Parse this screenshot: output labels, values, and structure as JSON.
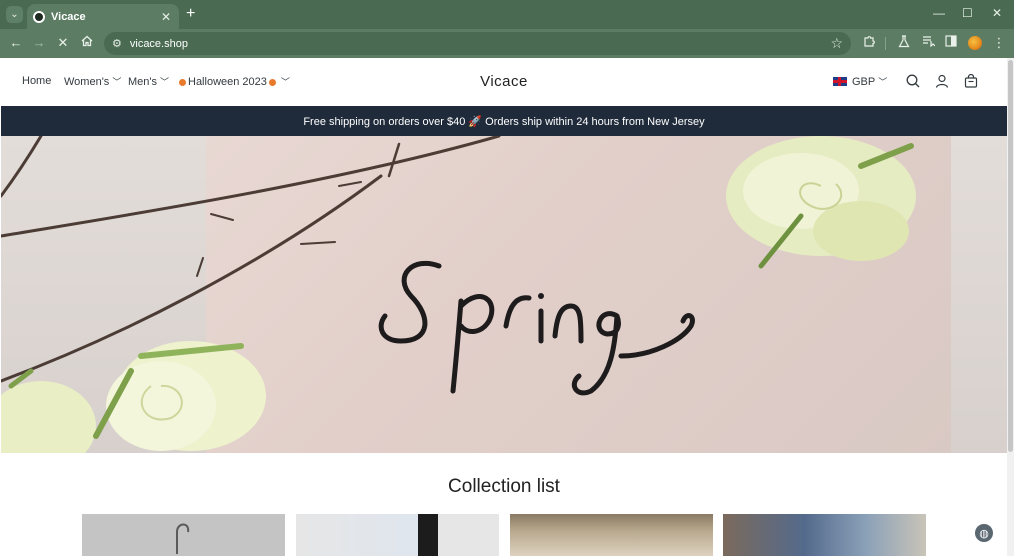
{
  "browser": {
    "tab_title": "Vicace",
    "url": "vicace.shop"
  },
  "icons": {
    "tab_list": "chevron-down-icon",
    "back": "back-arrow-icon",
    "forward": "forward-arrow-icon",
    "stop": "close-icon",
    "home": "home-icon",
    "site_info": "tune-icon",
    "bookmark": "star-icon",
    "extensions": "puzzle-icon",
    "labs": "flask-icon",
    "reading_list": "reading-list-icon",
    "side_panel": "side-panel-icon",
    "menu": "more-vert-icon"
  },
  "header": {
    "nav": [
      {
        "label": "Home"
      },
      {
        "label": "Women's"
      },
      {
        "label": "Men's"
      },
      {
        "label": "Halloween 2023"
      }
    ],
    "logo": "Vicace",
    "currency": "GBP"
  },
  "announcement": "Free shipping on orders over $40 🚀 Orders ship within 24 hours from New Jersey",
  "hero": {
    "lettering": "Spring"
  },
  "collection": {
    "title": "Collection list"
  },
  "colors": {
    "chrome": "#4a6b52",
    "toolbar": "#5c7d64",
    "announcement_bg": "#1f2b3b",
    "text": "#333a3f"
  }
}
